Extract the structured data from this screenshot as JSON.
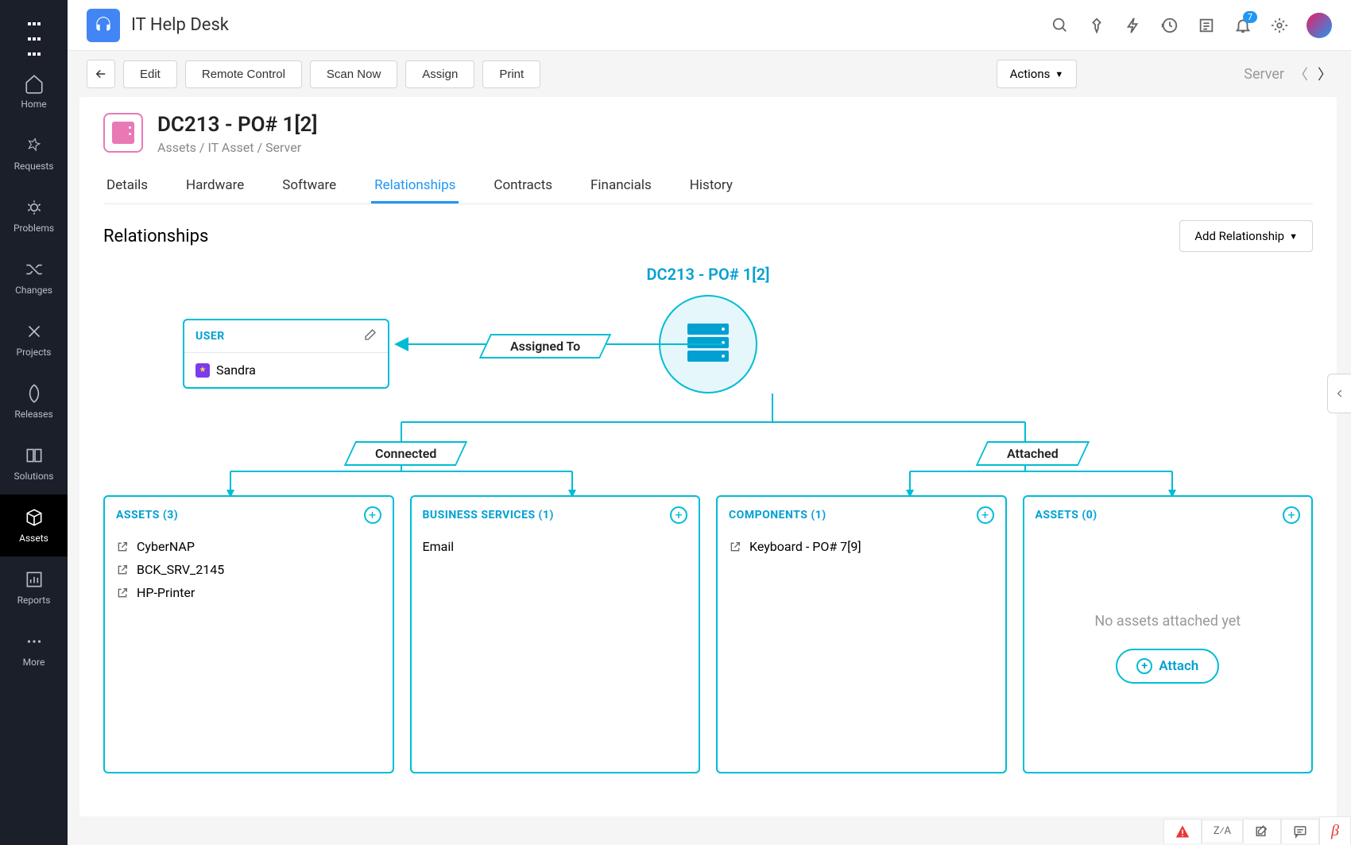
{
  "app": {
    "title": "IT Help Desk"
  },
  "notifications": {
    "count": "7"
  },
  "sidebar": {
    "items": [
      {
        "label": "Home"
      },
      {
        "label": "Requests"
      },
      {
        "label": "Problems"
      },
      {
        "label": "Changes"
      },
      {
        "label": "Projects"
      },
      {
        "label": "Releases"
      },
      {
        "label": "Solutions"
      },
      {
        "label": "Assets"
      },
      {
        "label": "Reports"
      },
      {
        "label": "More"
      }
    ]
  },
  "toolbar": {
    "buttons": [
      "Edit",
      "Remote Control",
      "Scan Now",
      "Assign",
      "Print"
    ],
    "actions_label": "Actions",
    "context": "Server"
  },
  "page": {
    "title": "DC213 - PO# 1[2]",
    "breadcrumb": "Assets  /  IT Asset /   Server"
  },
  "tabs": [
    "Details",
    "Hardware",
    "Software",
    "Relationships",
    "Contracts",
    "Financials",
    "History"
  ],
  "active_tab": "Relationships",
  "section": {
    "title": "Relationships",
    "add_button": "Add Relationship"
  },
  "diagram": {
    "root_label": "DC213 - PO# 1[2]",
    "user_card": {
      "title": "USER",
      "user": "Sandra"
    },
    "rel_assigned": "Assigned To",
    "rel_connected": "Connected",
    "rel_attached": "Attached",
    "cards": [
      {
        "title": "ASSETS (3)",
        "items": [
          "CyberNAP",
          "BCK_SRV_2145",
          "HP-Printer"
        ]
      },
      {
        "title": "BUSINESS SERVICES (1)",
        "items_plain": [
          "Email"
        ]
      },
      {
        "title": "COMPONENTS (1)",
        "items": [
          "Keyboard - PO# 7[9]"
        ]
      },
      {
        "title": "ASSETS (0)",
        "empty_text": "No assets attached yet",
        "attach_button": "Attach"
      }
    ]
  }
}
